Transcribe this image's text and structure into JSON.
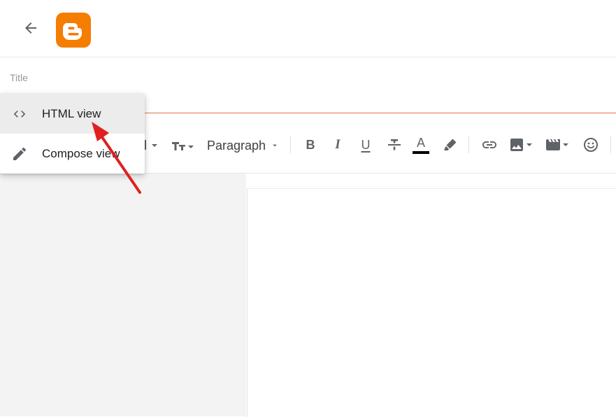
{
  "header": {
    "back_icon": "arrow-left-icon",
    "logo": "blogger-logo",
    "logo_color": "#f57d00"
  },
  "title": {
    "placeholder": "Title",
    "value": ""
  },
  "menu": {
    "items": [
      {
        "label": "HTML view",
        "icon": "code-brackets-icon",
        "selected": true
      },
      {
        "label": "Compose view",
        "icon": "pencil-icon",
        "selected": false
      }
    ]
  },
  "toolbar": {
    "paragraph_label": "Paragraph",
    "bold_label": "B",
    "italic_label": "I",
    "underline_label": "U",
    "strikethrough_label": "S",
    "text_color_label": "A",
    "text_color_value": "#000000",
    "icons": [
      "undo-partial-icon",
      "font-size-icon",
      "highlighter-icon",
      "link-icon",
      "image-icon",
      "video-icon",
      "emoji-icon"
    ]
  },
  "colors": {
    "accent": "#f57d00",
    "title_underline": "#e8734a",
    "annotation_arrow": "#e02020"
  }
}
